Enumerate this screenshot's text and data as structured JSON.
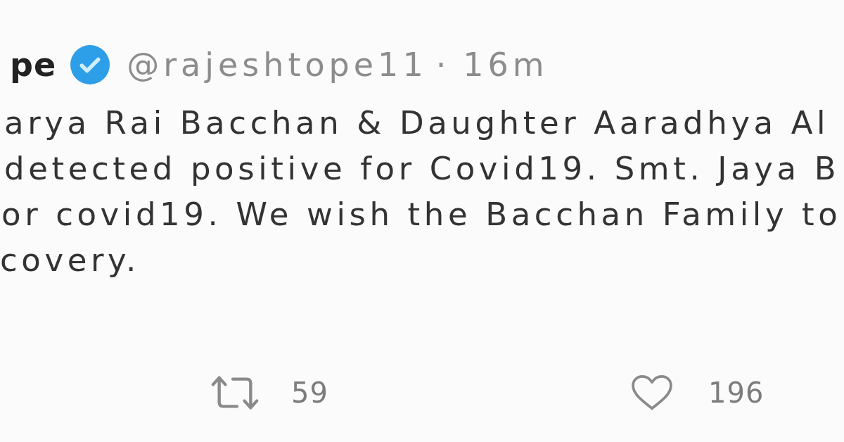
{
  "tweet": {
    "author_name": "pe",
    "verified": true,
    "handle": "@rajeshtope11",
    "separator": "·",
    "time": "16m",
    "text_lines": [
      "arya Rai Bacchan & Daughter Aaradhya Al",
      "detected positive for Covid19. Smt. Jaya B",
      "or covid19. We wish the Bacchan Family to",
      "covery."
    ],
    "actions": [
      {
        "kind": "retweet",
        "count": "59"
      },
      {
        "kind": "like",
        "count": "196"
      }
    ]
  }
}
